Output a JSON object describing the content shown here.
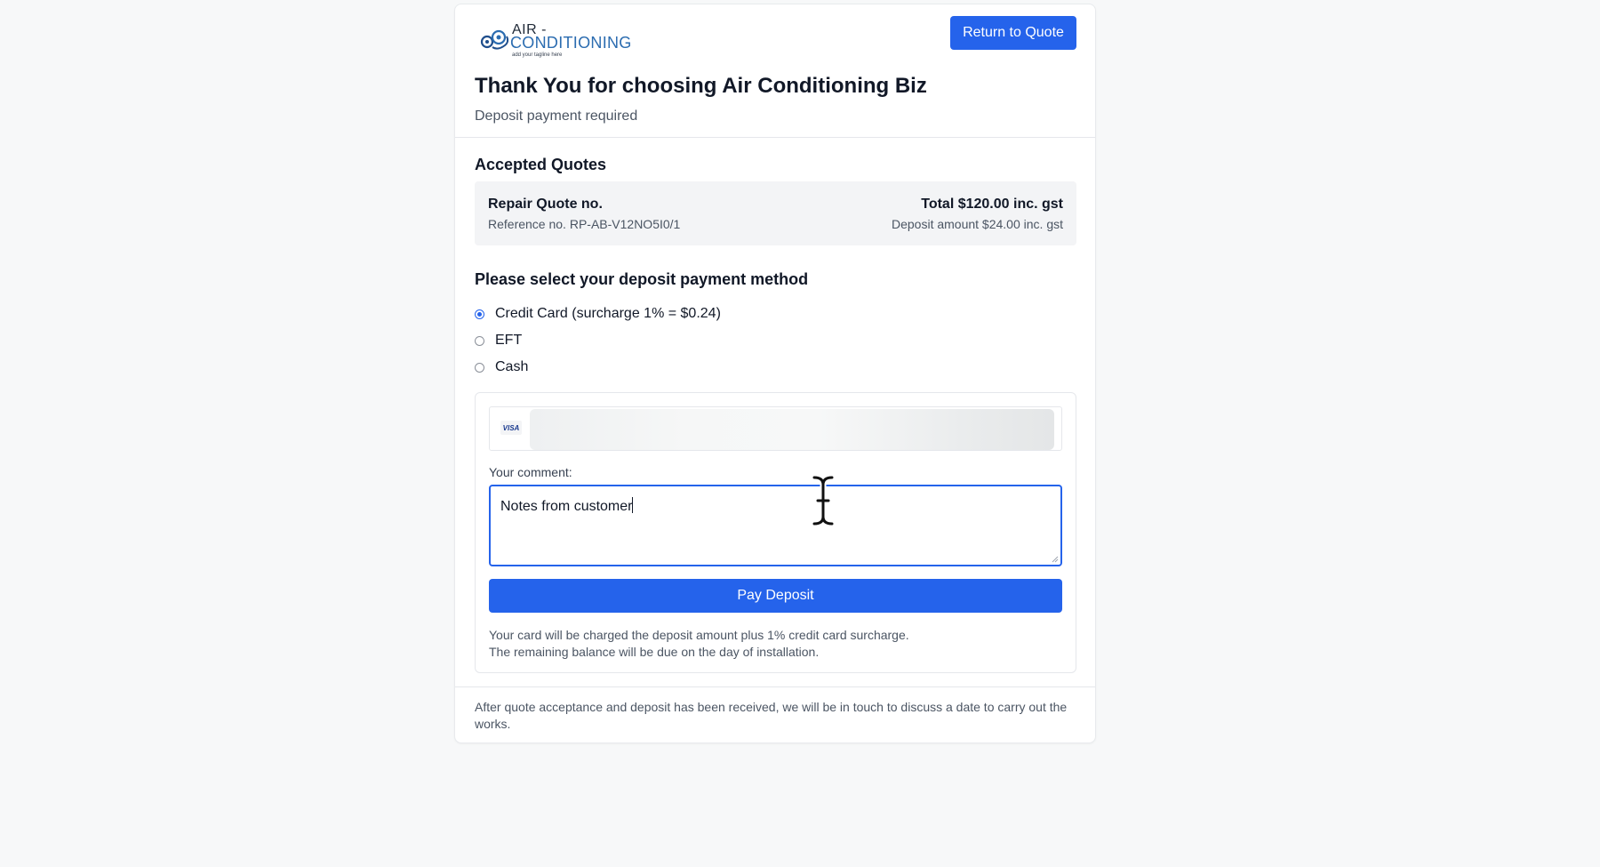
{
  "header": {
    "logo": {
      "line1": "AIR -",
      "line2": "CONDITIONING",
      "tagline": "add your tagline here"
    },
    "return_button": "Return to Quote",
    "title": "Thank You for choosing Air Conditioning Biz",
    "subtitle": "Deposit payment required"
  },
  "accepted_quotes": {
    "heading": "Accepted Quotes",
    "items": [
      {
        "name": "Repair Quote no.",
        "reference": "Reference no. RP-AB-V12NO5I0/1",
        "total": "Total $120.00 inc. gst",
        "deposit": "Deposit amount $24.00 inc. gst"
      }
    ]
  },
  "payment": {
    "heading": "Please select your deposit payment method",
    "methods": [
      {
        "label": "Credit Card (surcharge 1% = $0.24)",
        "selected": true
      },
      {
        "label": "EFT",
        "selected": false
      },
      {
        "label": "Cash",
        "selected": false
      }
    ],
    "card_icon": "visa-icon",
    "card_brand": "VISA",
    "comment_label": "Your comment:",
    "comment_value": "Notes from customer",
    "pay_button": "Pay Deposit",
    "note_line1": "Your card will be charged the deposit amount plus 1% credit card surcharge.",
    "note_line2": "The remaining balance will be due on the day of installation."
  },
  "footer": {
    "text": "After quote acceptance and deposit has been received, we will be in touch to discuss a date to carry out the works."
  },
  "colors": {
    "accent": "#2563eb",
    "background": "#f7f8f9",
    "card": "#ffffff"
  }
}
